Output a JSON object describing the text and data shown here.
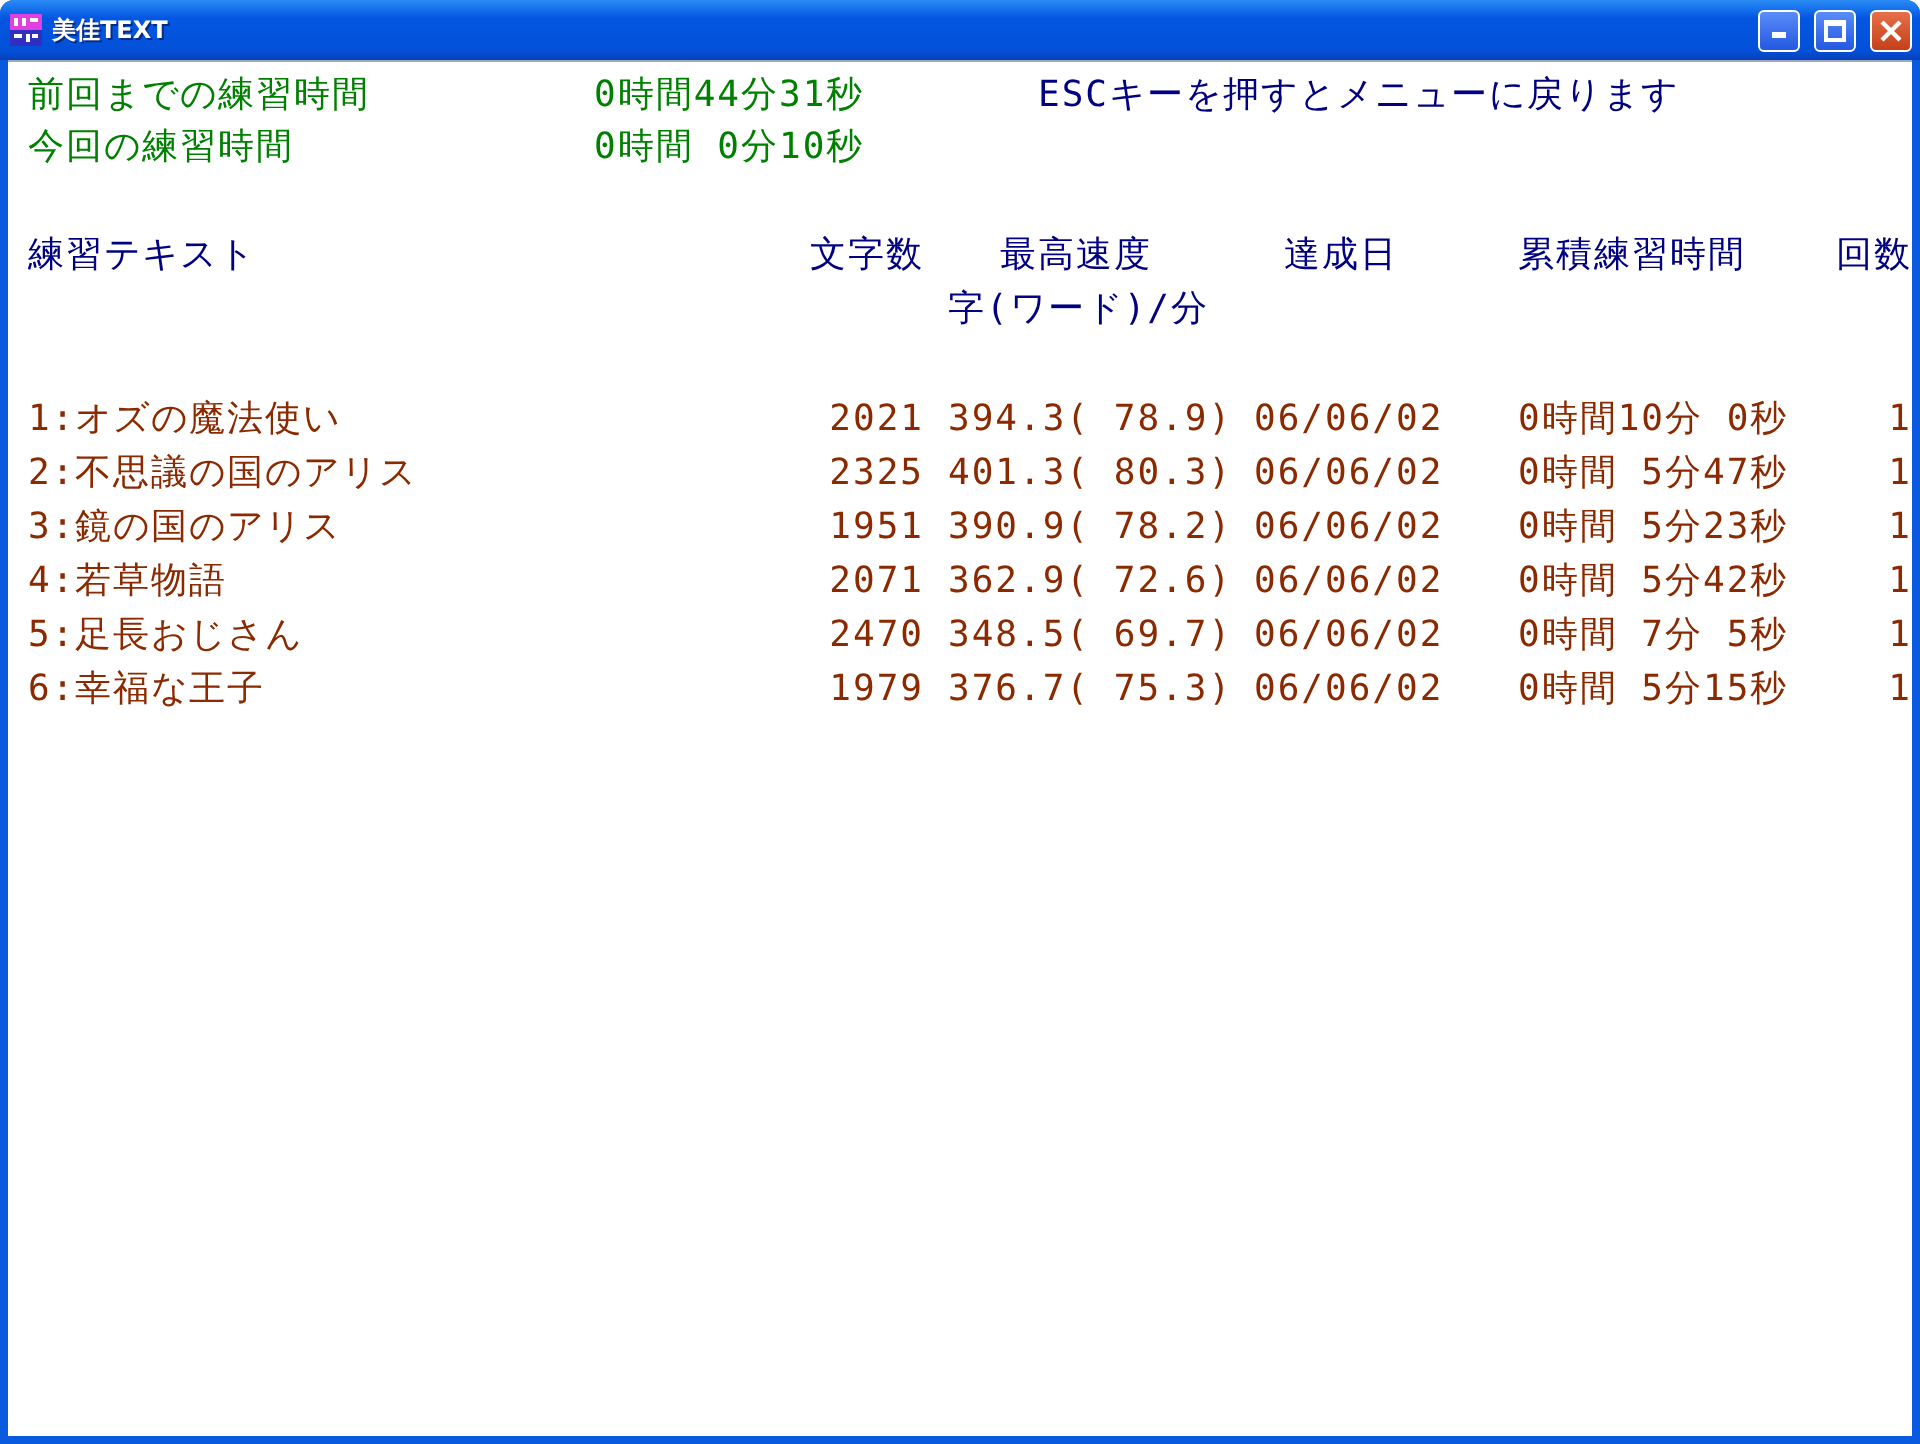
{
  "window": {
    "title": "美佳TEXT"
  },
  "summary": [
    {
      "label": "前回までの練習時間",
      "value": "0時間44分31秒"
    },
    {
      "label": "今回の練習時間",
      "value": "0時間 0分10秒"
    }
  ],
  "hint": "ESCキーを押すとメニューに戻ります",
  "table": {
    "columns": [
      "練習テキスト",
      "文字数",
      "最高速度",
      "達成日",
      "累積練習時間",
      "回数"
    ],
    "speed_unit": "字(ワード)/分",
    "rows": [
      [
        "1:オズの魔法使い",
        "2021",
        "394.3( 78.9)",
        "06/06/02",
        "0時間10分 0秒",
        "1"
      ],
      [
        "2:不思議の国のアリス",
        "2325",
        "401.3( 80.3)",
        "06/06/02",
        "0時間 5分47秒",
        "1"
      ],
      [
        "3:鏡の国のアリス",
        "1951",
        "390.9( 78.2)",
        "06/06/02",
        "0時間 5分23秒",
        "1"
      ],
      [
        "4:若草物語",
        "2071",
        "362.9( 72.6)",
        "06/06/02",
        "0時間 5分42秒",
        "1"
      ],
      [
        "5:足長おじさん",
        "2470",
        "348.5( 69.7)",
        "06/06/02",
        "0時間 7分 5秒",
        "1"
      ],
      [
        "6:幸福な王子",
        "1979",
        "376.7( 75.3)",
        "06/06/02",
        "0時間 5分15秒",
        "1"
      ]
    ]
  }
}
